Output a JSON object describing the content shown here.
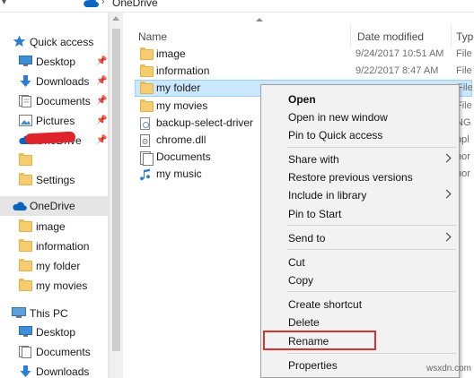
{
  "breadcrumb": {
    "location": "OneDrive"
  },
  "nav": {
    "quick_access": "Quick access",
    "items": [
      {
        "label": "Desktop",
        "icon": "desktop-icon",
        "pinned": true
      },
      {
        "label": "Downloads",
        "icon": "download-arrow-icon",
        "pinned": true
      },
      {
        "label": "Documents",
        "icon": "documents-icon",
        "pinned": true
      },
      {
        "label": "Pictures",
        "icon": "pictures-icon",
        "pinned": true
      },
      {
        "label": "OneDrive",
        "icon": "cloud-icon",
        "pinned": true
      },
      {
        "label": "",
        "icon": "folder-icon",
        "pinned": false
      },
      {
        "label": "Settings",
        "icon": "folder-icon",
        "pinned": false
      }
    ],
    "onedrive": "OneDrive",
    "onedrive_children": [
      "image",
      "information",
      "my folder",
      "my movies"
    ],
    "this_pc": "This PC",
    "pc_children": [
      "Desktop",
      "Documents",
      "Downloads"
    ]
  },
  "columns": {
    "name": "Name",
    "date": "Date modified",
    "type": "Type"
  },
  "files": [
    {
      "name": "image",
      "date": "9/24/2017 10:51 AM",
      "type": "File f",
      "kind": "folder"
    },
    {
      "name": "information",
      "date": "9/22/2017 8:47 AM",
      "type": "File f",
      "kind": "folder"
    },
    {
      "name": "my folder",
      "date": "",
      "type": "File f",
      "kind": "folder"
    },
    {
      "name": "my movies",
      "date": "",
      "type": "File f",
      "kind": "folder"
    },
    {
      "name": "backup-select-driver",
      "date": "",
      "type": "NG",
      "kind": "file"
    },
    {
      "name": "chrome.dll",
      "date": "",
      "type": "ppl",
      "kind": "file"
    },
    {
      "name": "Documents",
      "date": "",
      "type": "hor",
      "kind": "docs"
    },
    {
      "name": "my music",
      "date": "",
      "type": "hor",
      "kind": "music"
    }
  ],
  "context_menu": {
    "open": "Open",
    "open_new_window": "Open in new window",
    "pin_quick_access": "Pin to Quick access",
    "share_with": "Share with",
    "restore_versions": "Restore previous versions",
    "include_library": "Include in library",
    "pin_start": "Pin to Start",
    "send_to": "Send to",
    "cut": "Cut",
    "copy": "Copy",
    "create_shortcut": "Create shortcut",
    "delete": "Delete",
    "rename": "Rename",
    "properties": "Properties"
  },
  "colors": {
    "highlight": "#d9332d",
    "selection": "#cce8ff",
    "accent": "#0a64c2"
  },
  "watermark": "wsxdn.com"
}
